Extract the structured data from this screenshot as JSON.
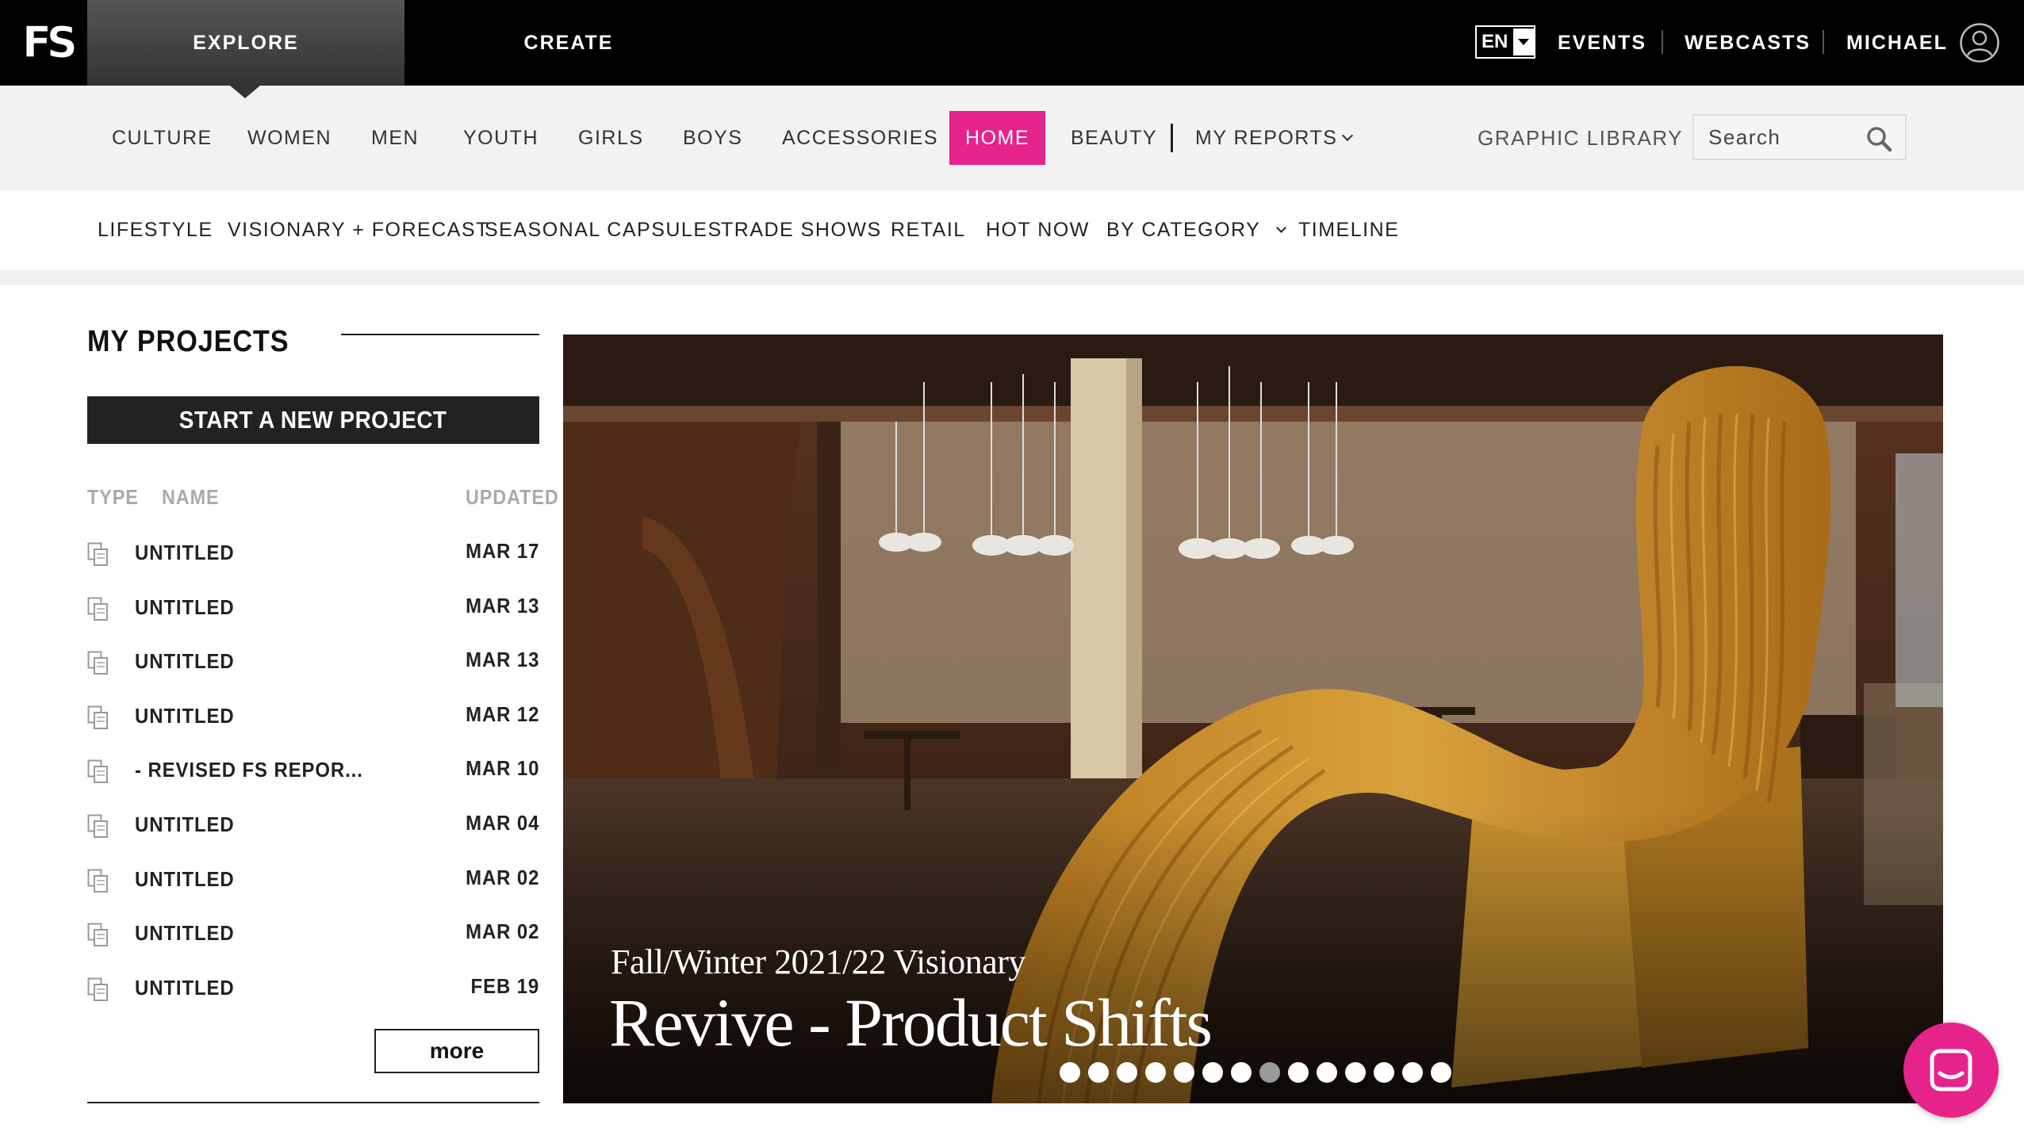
{
  "topbar": {
    "logo": "FS",
    "tabs": [
      {
        "label": "EXPLORE"
      },
      {
        "label": "CREATE"
      }
    ],
    "language": "EN",
    "links": {
      "events": "EVENTS",
      "webcasts": "WEBCASTS",
      "user": "MICHAEL"
    }
  },
  "categories": {
    "items": [
      {
        "label": "CULTURE"
      },
      {
        "label": "WOMEN"
      },
      {
        "label": "MEN"
      },
      {
        "label": "YOUTH"
      },
      {
        "label": "GIRLS"
      },
      {
        "label": "BOYS"
      },
      {
        "label": "ACCESSORIES"
      },
      {
        "label": "HOME",
        "active": true
      },
      {
        "label": "BEAUTY"
      }
    ],
    "my_reports": "MY REPORTS",
    "graphic_library": "GRAPHIC LIBRARY",
    "search_placeholder": "Search"
  },
  "subnav": {
    "items": [
      {
        "label": "LIFESTYLE"
      },
      {
        "label": "VISIONARY + FORECAST"
      },
      {
        "label": "SEASONAL CAPSULES"
      },
      {
        "label": "TRADE SHOWS"
      },
      {
        "label": "RETAIL"
      },
      {
        "label": "HOT NOW"
      },
      {
        "label": "BY CATEGORY"
      },
      {
        "label": "TIMELINE"
      }
    ]
  },
  "projects": {
    "title": "MY PROJECTS",
    "new_button": "START A NEW PROJECT",
    "columns": {
      "type": "TYPE",
      "name": "NAME",
      "updated": "UPDATED"
    },
    "rows": [
      {
        "name": "UNTITLED",
        "date": "MAR 17"
      },
      {
        "name": "UNTITLED",
        "date": "MAR 13"
      },
      {
        "name": "UNTITLED",
        "date": "MAR 13"
      },
      {
        "name": "UNTITLED",
        "date": "MAR 12"
      },
      {
        "name": "- REVISED FS REPOR...",
        "date": "MAR 10"
      },
      {
        "name": "UNTITLED",
        "date": "MAR 04"
      },
      {
        "name": "UNTITLED",
        "date": "MAR 02"
      },
      {
        "name": "UNTITLED",
        "date": "MAR 02"
      },
      {
        "name": "UNTITLED",
        "date": "FEB 19"
      }
    ],
    "more": "more"
  },
  "hero": {
    "subtitle": "Fall/Winter 2021/22 Visionary",
    "title": "Revive - Product Shifts",
    "slide_count": 14,
    "active_slide": 8
  },
  "colors": {
    "accent": "#e6238a",
    "topbar": "#000000",
    "catbar": "#f2f2f2"
  },
  "icons": {
    "search": "search-icon",
    "user": "user-avatar-icon",
    "project": "project-copy-icon",
    "chat": "chat-icon"
  }
}
